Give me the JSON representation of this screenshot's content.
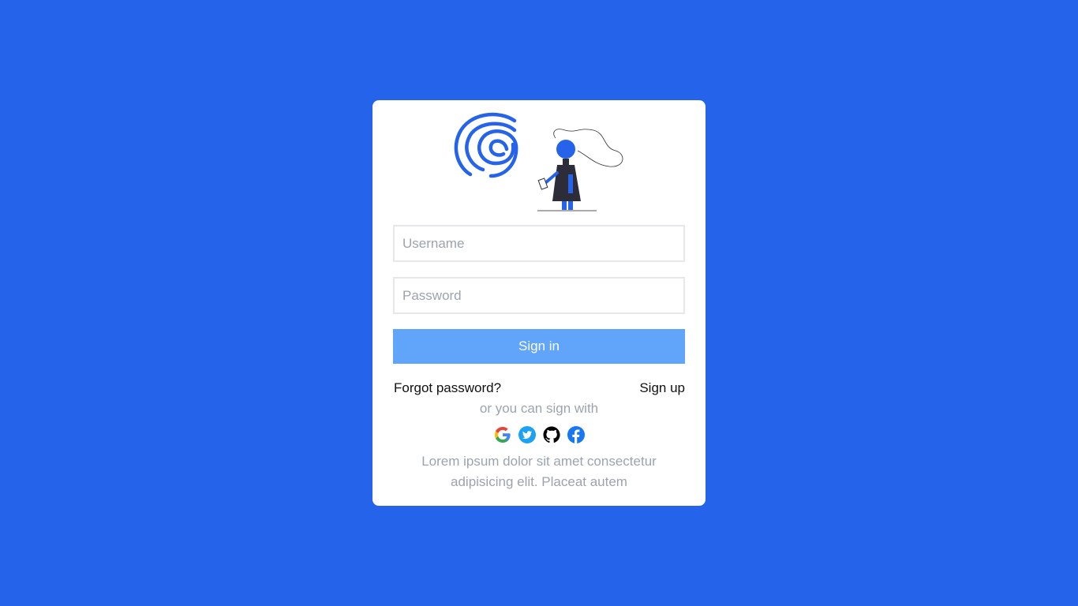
{
  "login": {
    "username_placeholder": "Username",
    "password_placeholder": "Password",
    "signin_label": "Sign in",
    "forgot_label": "Forgot password?",
    "signup_label": "Sign up",
    "alt_signin_text": "or you can sign with",
    "socials": [
      {
        "name": "google-icon"
      },
      {
        "name": "twitter-icon"
      },
      {
        "name": "github-icon"
      },
      {
        "name": "facebook-icon"
      }
    ],
    "footer_text": "Lorem ipsum dolor sit amet consectetur adipisicing elit. Placeat autem"
  },
  "colors": {
    "background": "#2563eb",
    "card": "#ffffff",
    "button": "#60a5fa",
    "muted_text": "#9ca3af"
  }
}
